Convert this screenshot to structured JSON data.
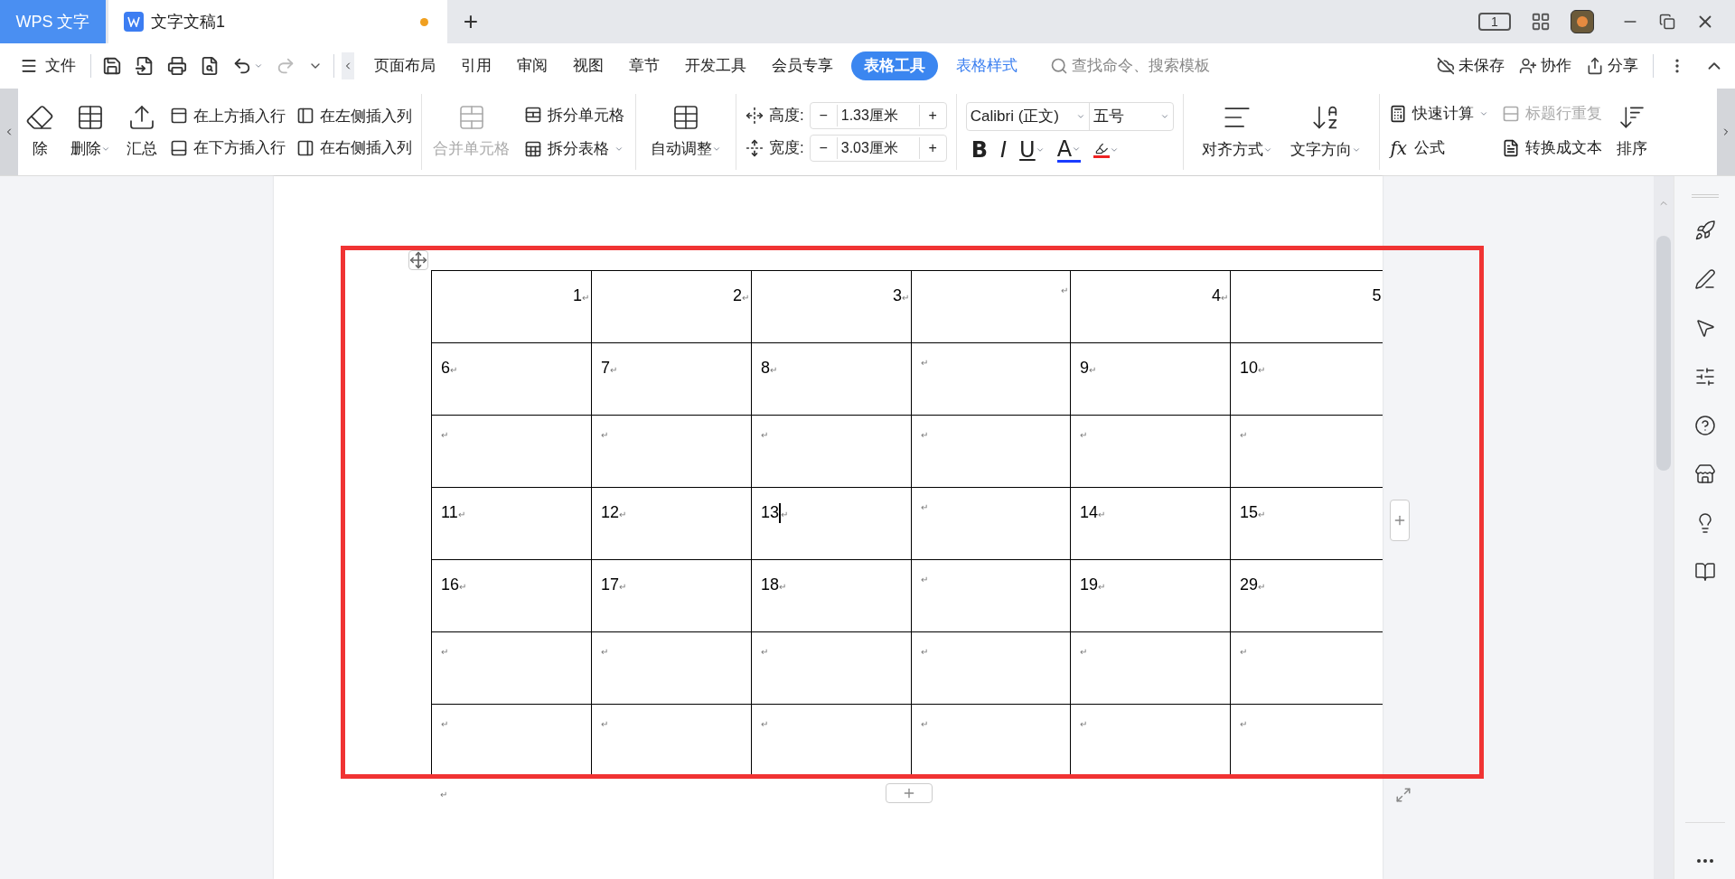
{
  "title_bar": {
    "app_tab": "WPS 文字",
    "doc_tab": {
      "title": "文字文稿1",
      "unsaved": true
    },
    "new_tab": "+",
    "tablet_badge": "1"
  },
  "menu_bar": {
    "file": "文件",
    "tabs": [
      {
        "label": "页面布局",
        "selected": false,
        "kind": "standard"
      },
      {
        "label": "引用",
        "selected": false,
        "kind": "standard"
      },
      {
        "label": "审阅",
        "selected": false,
        "kind": "standard"
      },
      {
        "label": "视图",
        "selected": false,
        "kind": "standard"
      },
      {
        "label": "章节",
        "selected": false,
        "kind": "standard"
      },
      {
        "label": "开发工具",
        "selected": false,
        "kind": "standard"
      },
      {
        "label": "会员专享",
        "selected": false,
        "kind": "standard"
      },
      {
        "label": "表格工具",
        "selected": true,
        "kind": "contextual"
      },
      {
        "label": "表格样式",
        "selected": false,
        "kind": "contextual"
      }
    ],
    "search": {
      "placeholder": "查找命令、搜索模板"
    },
    "actions": [
      "未保存",
      "协作",
      "分享"
    ]
  },
  "ribbon": {
    "left_tools": [
      {
        "label": "除",
        "dropdown": false
      },
      {
        "label": "删除",
        "dropdown": true
      },
      {
        "label": "汇总",
        "dropdown": false
      }
    ],
    "insert": [
      "在上方插入行",
      "在左侧插入列",
      "在下方插入行",
      "在右侧插入列"
    ],
    "merge": {
      "label": "合并单元格",
      "disabled": true
    },
    "split": [
      {
        "label": "拆分单元格",
        "dropdown": false
      },
      {
        "label": "拆分表格",
        "dropdown": true
      }
    ],
    "autofit": {
      "label": "自动调整",
      "dropdown": true
    },
    "size": [
      {
        "label": "高度:",
        "minus": "−",
        "value": "1.33厘米",
        "plus": "+"
      },
      {
        "label": "宽度:",
        "minus": "−",
        "value": "3.03厘米",
        "plus": "+"
      }
    ],
    "font": {
      "family": "Calibri (正文)",
      "size": "五号"
    },
    "format": [
      {
        "glyph": "B",
        "dropdown": false
      },
      {
        "glyph": "I",
        "dropdown": false
      },
      {
        "glyph": "U",
        "dropdown": true
      },
      {
        "glyph": "A",
        "dropdown": true
      }
    ],
    "highlight": {
      "dropdown": true
    },
    "align": {
      "label": "对齐方式",
      "dropdown": true
    },
    "direction": {
      "label": "文字方向",
      "dropdown": true
    },
    "calc": [
      {
        "label": "快速计算",
        "dropdown": true,
        "disabled": false
      },
      {
        "label": "标题行重复",
        "dropdown": false,
        "disabled": true
      },
      {
        "label": "公式",
        "dropdown": false,
        "disabled": false,
        "glyph": "fx"
      },
      {
        "label": "转换成文本",
        "dropdown": false,
        "disabled": false
      }
    ],
    "sort": {
      "label": "排序"
    }
  },
  "table": {
    "rows": [
      {
        "kind": "right_aligned",
        "cells": [
          {
            "text": "1",
            "mark": "↵",
            "caret": false
          },
          {
            "text": "2",
            "mark": "↵",
            "caret": false
          },
          {
            "text": "3",
            "mark": "↵",
            "caret": false
          },
          {
            "text": "",
            "mark": "↵",
            "caret": false
          },
          {
            "text": "4",
            "mark": "↵",
            "caret": false
          },
          {
            "text": "5",
            "caret": false
          }
        ]
      },
      {
        "kind": "left_aligned",
        "cells": [
          {
            "text": "6",
            "mark": "↵",
            "caret": false
          },
          {
            "text": "7",
            "mark": "↵",
            "caret": false
          },
          {
            "text": "8",
            "mark": "↵",
            "caret": false
          },
          {
            "text": "",
            "mark": "↵",
            "caret": false
          },
          {
            "text": "9",
            "mark": "↵",
            "caret": false
          },
          {
            "text": "10",
            "mark": "↵",
            "caret": false
          }
        ]
      },
      {
        "kind": "left_aligned",
        "cells": [
          {
            "text": "",
            "mark": "↵",
            "caret": false
          },
          {
            "text": "",
            "mark": "↵",
            "caret": false
          },
          {
            "text": "",
            "mark": "↵",
            "caret": false
          },
          {
            "text": "",
            "mark": "↵",
            "caret": false
          },
          {
            "text": "",
            "mark": "↵",
            "caret": false
          },
          {
            "text": "",
            "mark": "↵",
            "caret": false
          }
        ]
      },
      {
        "kind": "left_aligned",
        "cells": [
          {
            "text": "11",
            "mark": "↵",
            "caret": false
          },
          {
            "text": "12",
            "mark": "↵",
            "caret": false
          },
          {
            "text": "13",
            "mark": "↵",
            "caret": true
          },
          {
            "text": "",
            "mark": "↵",
            "caret": false
          },
          {
            "text": "14",
            "mark": "↵",
            "caret": false
          },
          {
            "text": "15",
            "mark": "↵",
            "caret": false
          }
        ]
      },
      {
        "kind": "left_aligned",
        "cells": [
          {
            "text": "16",
            "mark": "↵",
            "caret": false
          },
          {
            "text": "17",
            "mark": "↵",
            "caret": false
          },
          {
            "text": "18",
            "mark": "↵",
            "caret": false
          },
          {
            "text": "",
            "mark": "↵",
            "caret": false
          },
          {
            "text": "19",
            "mark": "↵",
            "caret": false
          },
          {
            "text": "29",
            "mark": "↵",
            "caret": false
          }
        ]
      },
      {
        "kind": "left_aligned",
        "cells": [
          {
            "text": "",
            "mark": "↵",
            "caret": false
          },
          {
            "text": "",
            "mark": "↵",
            "caret": false
          },
          {
            "text": "",
            "mark": "↵",
            "caret": false
          },
          {
            "text": "",
            "mark": "↵",
            "caret": false
          },
          {
            "text": "",
            "mark": "↵",
            "caret": false
          },
          {
            "text": "",
            "mark": "↵",
            "caret": false
          }
        ]
      },
      {
        "kind": "left_aligned",
        "cells": [
          {
            "text": "",
            "mark": "↵",
            "caret": false
          },
          {
            "text": "",
            "mark": "↵",
            "caret": false
          },
          {
            "text": "",
            "mark": "↵",
            "caret": false
          },
          {
            "text": "",
            "mark": "↵",
            "caret": false
          },
          {
            "text": "",
            "mark": "↵",
            "caret": false
          },
          {
            "text": "",
            "mark": "↵",
            "caret": false
          }
        ]
      }
    ],
    "after_mark": "↵"
  }
}
